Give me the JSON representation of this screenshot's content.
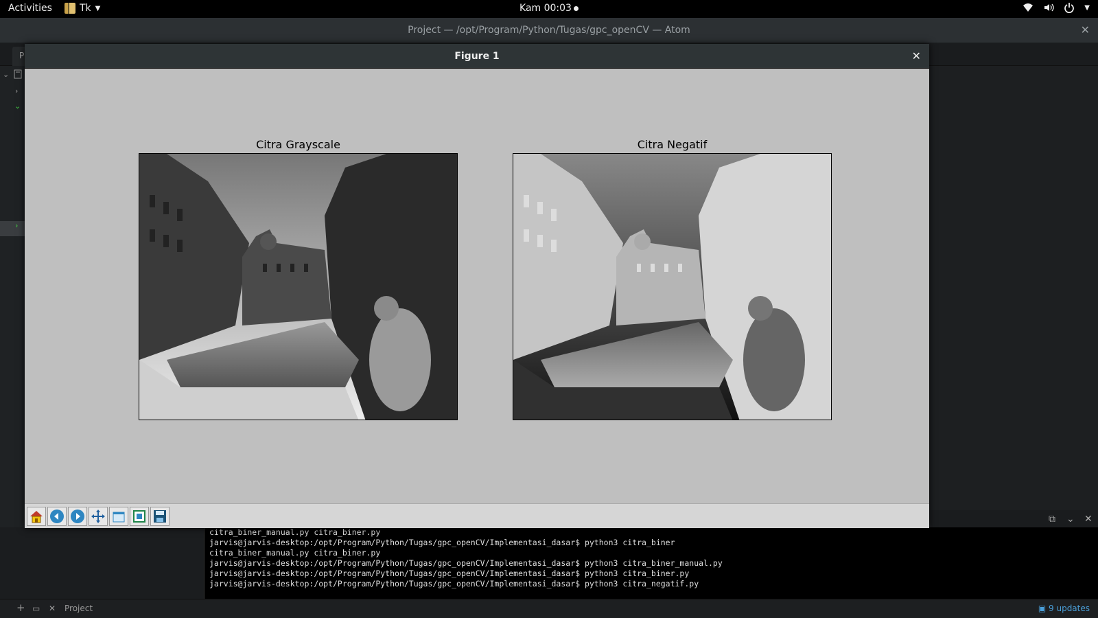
{
  "topbar": {
    "activities": "Activities",
    "app_name": "Tk",
    "clock": "Kam 00:03"
  },
  "atom": {
    "window_title": "Project — /opt/Program/Python/Tugas/gpc_openCV — Atom",
    "tab_initial": "P"
  },
  "figure": {
    "window_title": "Figure 1",
    "left_title": "Citra Grayscale",
    "right_title": "Citra Negatif",
    "toolbar": [
      "home-icon",
      "back-icon",
      "forward-icon",
      "pan-icon",
      "zoom-icon",
      "subplots-icon",
      "save-icon"
    ]
  },
  "terminal": {
    "lines": [
      "citra_biner_manual.py  citra_biner.py",
      "jarvis@jarvis-desktop:/opt/Program/Python/Tugas/gpc_openCV/Implementasi_dasar$ python3 citra_biner",
      "citra_biner_manual.py  citra_biner.py",
      "jarvis@jarvis-desktop:/opt/Program/Python/Tugas/gpc_openCV/Implementasi_dasar$ python3 citra_biner_manual.py",
      "jarvis@jarvis-desktop:/opt/Program/Python/Tugas/gpc_openCV/Implementasi_dasar$ python3 citra_biner.py",
      "jarvis@jarvis-desktop:/opt/Program/Python/Tugas/gpc_openCV/Implementasi_dasar$ python3 citra_negatif.py"
    ]
  },
  "statusbar": {
    "project_label": "Project",
    "updates": "9 updates"
  }
}
